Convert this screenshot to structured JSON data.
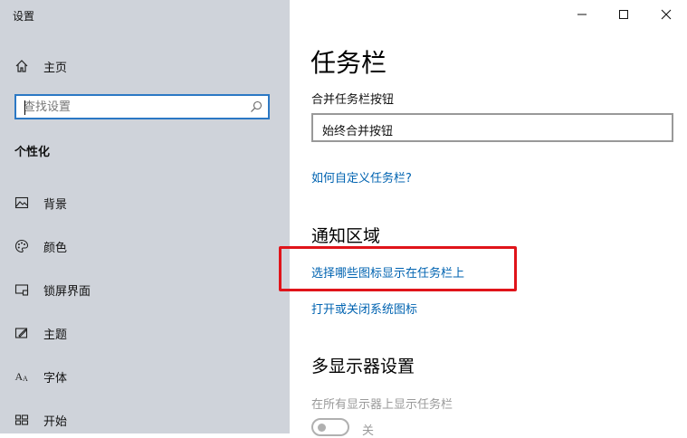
{
  "window": {
    "app_title": "设置",
    "controls": [
      "minimize",
      "maximize",
      "close"
    ]
  },
  "sidebar": {
    "home_label": "主页",
    "search": {
      "placeholder": "查找设置",
      "value": ""
    },
    "section_label": "个性化",
    "items": [
      {
        "label": "背景",
        "icon": "picture-icon"
      },
      {
        "label": "颜色",
        "icon": "palette-icon"
      },
      {
        "label": "锁屏界面",
        "icon": "lock-screen-icon"
      },
      {
        "label": "主题",
        "icon": "theme-brush-icon"
      },
      {
        "label": "字体",
        "icon": "font-icon"
      },
      {
        "label": "开始",
        "icon": "start-grid-icon"
      }
    ]
  },
  "main": {
    "title": "任务栏",
    "combine_label": "合并任务栏按钮",
    "combine_value": "始终合并按钮",
    "customize_link": "如何自定义任务栏?",
    "notification_heading": "通知区域",
    "select_icons_link": "选择哪些图标显示在任务栏上",
    "system_icons_link": "打开或关闭系统图标",
    "multi_display_heading": "多显示器设置",
    "show_all_label": "在所有显示器上显示任务栏",
    "toggle_state": "关",
    "colors": {
      "accent": "#0063b1",
      "highlight": "#e0141a",
      "sidebar_bg": "#cfd3da"
    }
  }
}
